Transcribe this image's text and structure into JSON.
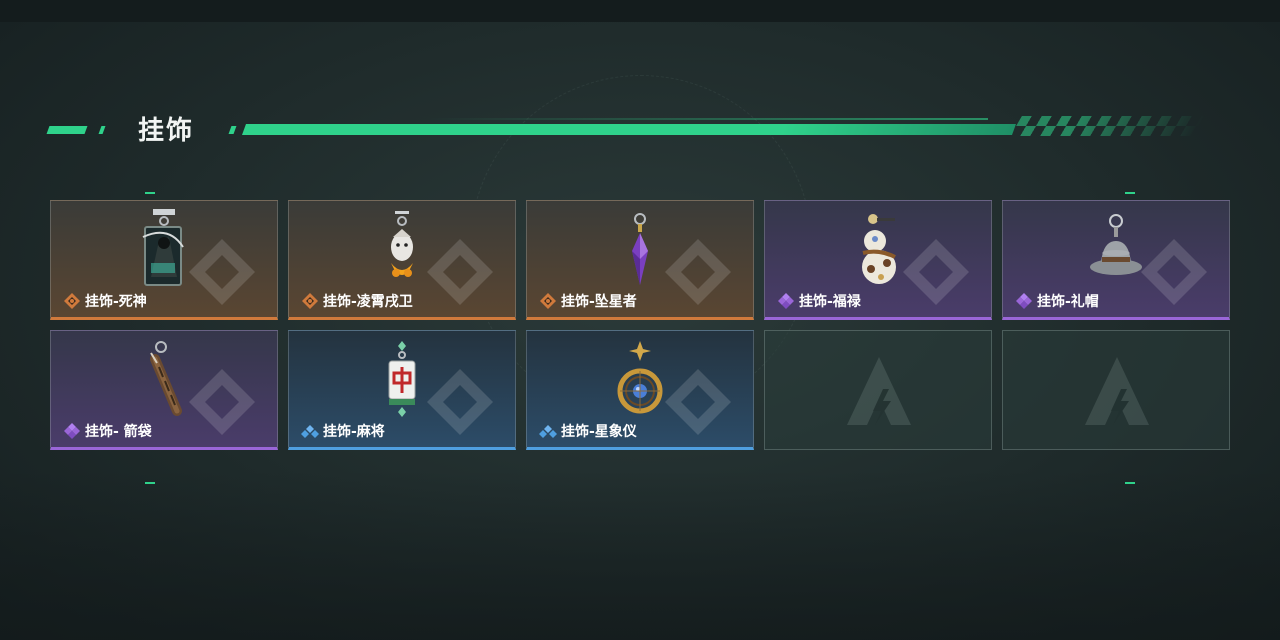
{
  "section": {
    "title": "挂饰"
  },
  "colors": {
    "accent": "#2fd28b",
    "orange": "#d07a3c",
    "purple": "#9a66d8",
    "blue": "#4f9fe0"
  },
  "items": [
    {
      "label": "挂饰-死神",
      "rarity": "orange",
      "icon": "reaper-card-charm"
    },
    {
      "label": "挂饰-凌霄戌卫",
      "rarity": "orange",
      "icon": "dog-guard-charm"
    },
    {
      "label": "挂饰-坠星者",
      "rarity": "orange",
      "icon": "purple-crystal-charm"
    },
    {
      "label": "挂饰-福禄",
      "rarity": "purple",
      "icon": "gourd-charm"
    },
    {
      "label": "挂饰-礼帽",
      "rarity": "purple",
      "icon": "top-hat-charm"
    },
    {
      "label": "挂饰- 箭袋",
      "rarity": "purple",
      "icon": "quiver-charm"
    },
    {
      "label": "挂饰-麻将",
      "rarity": "blue",
      "icon": "mahjong-tile-charm"
    },
    {
      "label": "挂饰-星象仪",
      "rarity": "blue",
      "icon": "astrolabe-charm"
    },
    {
      "label": "",
      "rarity": "empty",
      "icon": "empty-slot-logo"
    },
    {
      "label": "",
      "rarity": "empty",
      "icon": "empty-slot-logo"
    }
  ]
}
